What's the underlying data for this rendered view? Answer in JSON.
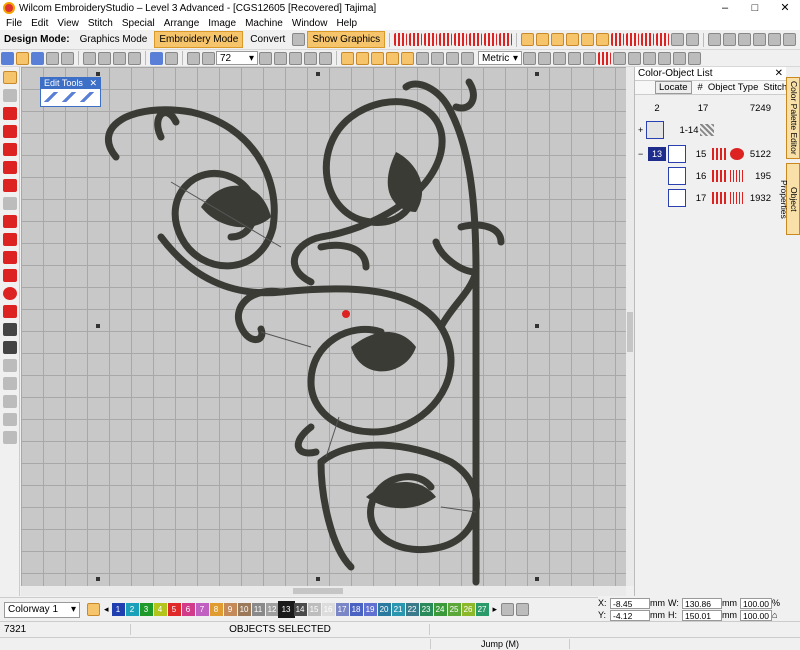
{
  "window": {
    "title": "Wilcom EmbroideryStudio – Level 3 Advanced - [CGS12605 [Recovered]          Tajima]",
    "minimize": "–",
    "maximize": "□",
    "close": "✕"
  },
  "menu": [
    "File",
    "Edit",
    "View",
    "Stitch",
    "Special",
    "Arrange",
    "Image",
    "Machine",
    "Window",
    "Help"
  ],
  "toolbar": {
    "design_mode_label": "Design Mode:",
    "graphics_mode": "Graphics Mode",
    "embroidery_mode": "Embroidery Mode",
    "convert": "Convert",
    "show_graphics": "Show Graphics",
    "zoom_value": "72",
    "units_value": "Metric"
  },
  "edit_tools": {
    "title": "Edit Tools",
    "close": "✕"
  },
  "color_object_list": {
    "title": "Color-Object List",
    "close": "✕",
    "locate": "Locate",
    "columns": [
      "#",
      "Object Type",
      "Stitches"
    ],
    "rows": [
      {
        "chip": "",
        "num": "2",
        "range": "17",
        "stitches": "7249"
      },
      {
        "chip": "",
        "num": "",
        "range": "1-14",
        "stitches": ""
      },
      {
        "chip": "13",
        "num": "",
        "range": "15",
        "stitches": "5122"
      },
      {
        "chip": "",
        "num": "",
        "range": "16",
        "stitches": "195"
      },
      {
        "chip": "",
        "num": "",
        "range": "17",
        "stitches": "1932"
      }
    ]
  },
  "side_tabs": {
    "palette_editor": "Color Palette Editor",
    "object_properties": "Object Properties"
  },
  "palette": {
    "colorway": "Colorway 1",
    "swatches": [
      {
        "label": "1",
        "color": "#1f3fb0"
      },
      {
        "label": "2",
        "color": "#1aa0b8"
      },
      {
        "label": "3",
        "color": "#1f9a2a"
      },
      {
        "label": "4",
        "color": "#b3c51b"
      },
      {
        "label": "5",
        "color": "#e02a2a"
      },
      {
        "label": "6",
        "color": "#d23a8a"
      },
      {
        "label": "7",
        "color": "#c060c0"
      },
      {
        "label": "8",
        "color": "#e09c30"
      },
      {
        "label": "9",
        "color": "#c48a5a"
      },
      {
        "label": "10",
        "color": "#9a7a5a"
      },
      {
        "label": "11",
        "color": "#8a8a8a"
      },
      {
        "label": "12",
        "color": "#a0a0a0"
      },
      {
        "label": "13",
        "color": "#1a1a1a"
      },
      {
        "label": "14",
        "color": "#4a4a4a"
      },
      {
        "label": "15",
        "color": "#bdbdbd"
      },
      {
        "label": "16",
        "color": "#dcdcdc"
      },
      {
        "label": "17",
        "color": "#7a86c6"
      },
      {
        "label": "18",
        "color": "#4a62c2"
      },
      {
        "label": "19",
        "color": "#6070d0"
      },
      {
        "label": "20",
        "color": "#2a7aa0"
      },
      {
        "label": "21",
        "color": "#2a96b0"
      },
      {
        "label": "22",
        "color": "#3a7a8a"
      },
      {
        "label": "23",
        "color": "#2a8a5a"
      },
      {
        "label": "24",
        "color": "#3a9a3a"
      },
      {
        "label": "25",
        "color": "#5aa83a"
      },
      {
        "label": "26",
        "color": "#8cb82a"
      },
      {
        "label": "27",
        "color": "#2a9a6a"
      }
    ],
    "selected": "13"
  },
  "coords": {
    "x_label": "X:",
    "x_value": "-8.45",
    "x_unit": "mm",
    "y_label": "Y:",
    "y_value": "-4.12",
    "y_unit": "mm",
    "w_label": "W:",
    "w_value": "130.86",
    "w_unit": "mm",
    "h_label": "H:",
    "h_value": "150.01",
    "h_unit": "mm",
    "w_pct": "100.00",
    "h_pct": "100.00",
    "pct": "%"
  },
  "status": {
    "left": "7321",
    "middle": "OBJECTS SELECTED",
    "bottom_middle": "Jump (M)"
  }
}
